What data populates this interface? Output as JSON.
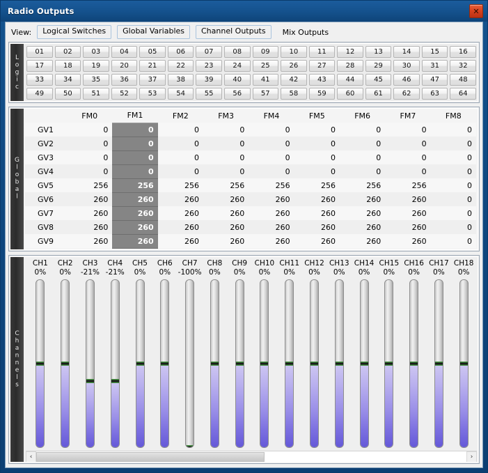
{
  "window": {
    "title": "Radio Outputs",
    "close_label": "✕"
  },
  "toolbar": {
    "view_label": "View:",
    "buttons": [
      {
        "label": "Logical Switches"
      },
      {
        "label": "Global Variables"
      },
      {
        "label": "Channel Outputs"
      }
    ],
    "plain_item": "Mix Outputs"
  },
  "logic": {
    "tab_label": "Logic",
    "switches": [
      "01",
      "02",
      "03",
      "04",
      "05",
      "06",
      "07",
      "08",
      "09",
      "10",
      "11",
      "12",
      "13",
      "14",
      "15",
      "16",
      "17",
      "18",
      "19",
      "20",
      "21",
      "22",
      "23",
      "24",
      "25",
      "26",
      "27",
      "28",
      "29",
      "30",
      "31",
      "32",
      "33",
      "34",
      "35",
      "36",
      "37",
      "38",
      "39",
      "40",
      "41",
      "42",
      "43",
      "44",
      "45",
      "46",
      "47",
      "48",
      "49",
      "50",
      "51",
      "52",
      "53",
      "54",
      "55",
      "56",
      "57",
      "58",
      "59",
      "60",
      "61",
      "62",
      "63",
      "64"
    ]
  },
  "global": {
    "tab_label": "Global",
    "columns": [
      "FM0",
      "FM1",
      "FM2",
      "FM3",
      "FM4",
      "FM5",
      "FM6",
      "FM7",
      "FM8"
    ],
    "selected_column": "FM1",
    "selected_column_index": 1,
    "rows": [
      {
        "name": "GV1",
        "values": [
          "0",
          "0",
          "0",
          "0",
          "0",
          "0",
          "0",
          "0",
          "0"
        ]
      },
      {
        "name": "GV2",
        "values": [
          "0",
          "0",
          "0",
          "0",
          "0",
          "0",
          "0",
          "0",
          "0"
        ]
      },
      {
        "name": "GV3",
        "values": [
          "0",
          "0",
          "0",
          "0",
          "0",
          "0",
          "0",
          "0",
          "0"
        ]
      },
      {
        "name": "GV4",
        "values": [
          "0",
          "0",
          "0",
          "0",
          "0",
          "0",
          "0",
          "0",
          "0"
        ]
      },
      {
        "name": "GV5",
        "values": [
          "256",
          "256",
          "256",
          "256",
          "256",
          "256",
          "256",
          "256",
          "0"
        ]
      },
      {
        "name": "GV6",
        "values": [
          "260",
          "260",
          "260",
          "260",
          "260",
          "260",
          "260",
          "260",
          "0"
        ]
      },
      {
        "name": "GV7",
        "values": [
          "260",
          "260",
          "260",
          "260",
          "260",
          "260",
          "260",
          "260",
          "0"
        ]
      },
      {
        "name": "GV8",
        "values": [
          "260",
          "260",
          "260",
          "260",
          "260",
          "260",
          "260",
          "260",
          "0"
        ]
      },
      {
        "name": "GV9",
        "values": [
          "260",
          "260",
          "260",
          "260",
          "260",
          "260",
          "260",
          "260",
          "0"
        ]
      }
    ]
  },
  "channels": {
    "tab_label": "Channels",
    "items": [
      {
        "name": "CH1",
        "value_label": "0%",
        "percent": 0
      },
      {
        "name": "CH2",
        "value_label": "0%",
        "percent": 0
      },
      {
        "name": "CH3",
        "value_label": "-21%",
        "percent": -21
      },
      {
        "name": "CH4",
        "value_label": "-21%",
        "percent": -21
      },
      {
        "name": "CH5",
        "value_label": "0%",
        "percent": 0
      },
      {
        "name": "CH6",
        "value_label": "0%",
        "percent": 0
      },
      {
        "name": "CH7",
        "value_label": "-100%",
        "percent": -100
      },
      {
        "name": "CH8",
        "value_label": "0%",
        "percent": 0
      },
      {
        "name": "CH9",
        "value_label": "0%",
        "percent": 0
      },
      {
        "name": "CH10",
        "value_label": "0%",
        "percent": 0
      },
      {
        "name": "CH11",
        "value_label": "0%",
        "percent": 0
      },
      {
        "name": "CH12",
        "value_label": "0%",
        "percent": 0
      },
      {
        "name": "CH13",
        "value_label": "0%",
        "percent": 0
      },
      {
        "name": "CH14",
        "value_label": "0%",
        "percent": 0
      },
      {
        "name": "CH15",
        "value_label": "0%",
        "percent": 0
      },
      {
        "name": "CH16",
        "value_label": "0%",
        "percent": 0
      },
      {
        "name": "CH17",
        "value_label": "0%",
        "percent": 0
      },
      {
        "name": "CH18",
        "value_label": "0%",
        "percent": 0
      }
    ],
    "scrollbar": {
      "left_arrow": "‹",
      "right_arrow": "›",
      "thumb_fraction": 0.53
    }
  },
  "colors": {
    "titlebar": "#15528e",
    "close_button": "#d8431f",
    "gauge_fill": "#7b6fe0",
    "gauge_marker": "#1b1b1b",
    "marker_accent": "#2a5c2a",
    "selected_cell": "#858585",
    "panel_bg": "#f0f0f0"
  }
}
